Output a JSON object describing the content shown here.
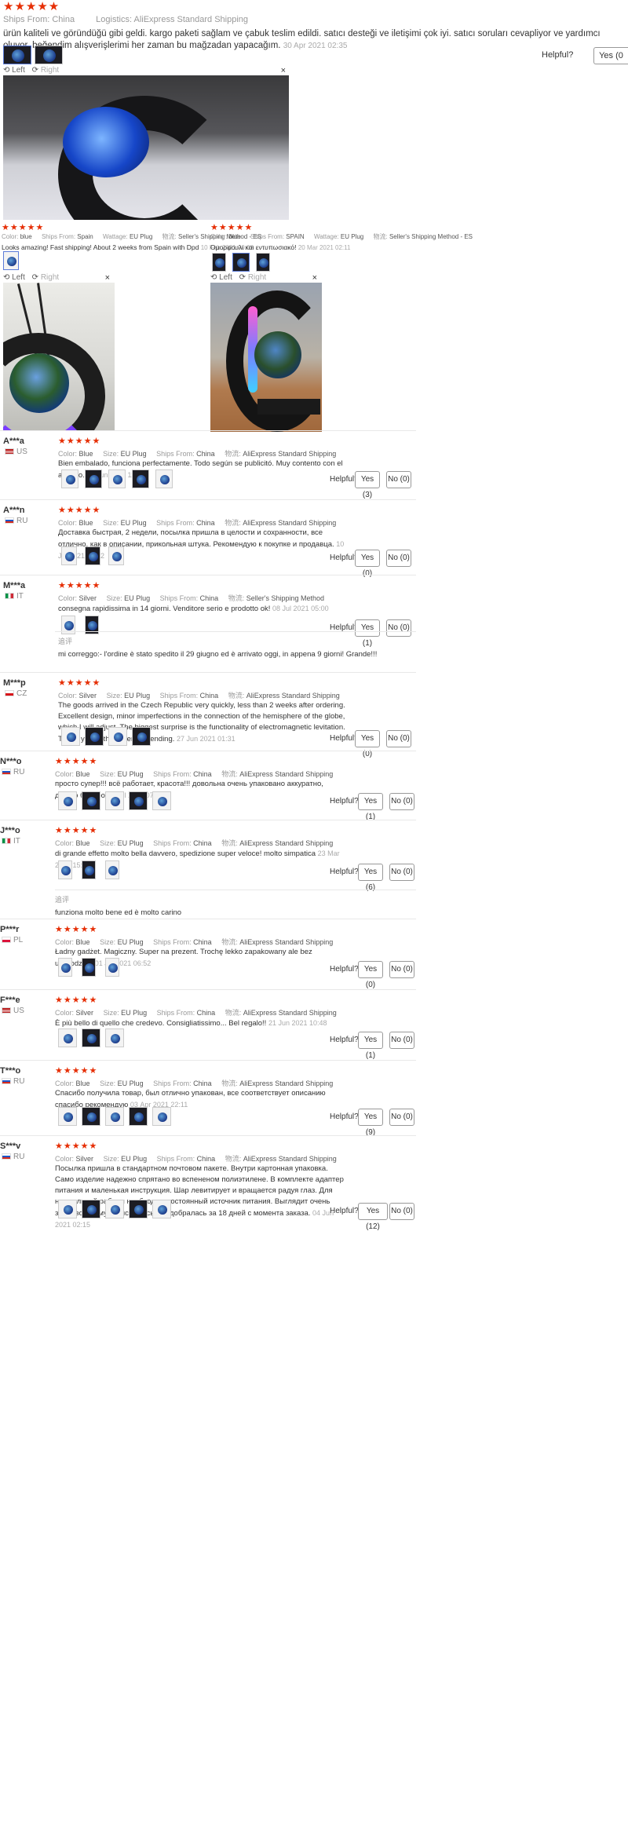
{
  "top_review": {
    "stars": "★★★★★",
    "ships_from_key": "Ships From:",
    "ships_from": "China",
    "logistics_key": "Logistics:",
    "logistics": "AliExpress Standard Shipping",
    "text": "ürün kaliteli ve göründüğü gibi geldi. kargo paketi sağlam ve çabuk teslim edildi. satıcı desteği ve iletişimi çok iyi. satıcı soruları cevapliyor ve yardımcı oluyor. beğendim alışverişlerimi her zaman bu mağzadan yapacağım.",
    "date": "30 Apr 2021 02:35",
    "helpful_label": "Helpful?",
    "yes_label": "Yes (0"
  },
  "viewer": {
    "left": "Left",
    "right": "Right",
    "close": "×"
  },
  "left_review": {
    "stars": "★★★★★",
    "color_key": "Color:",
    "color": "blue",
    "ships_key": "Ships From:",
    "ships": "Spain",
    "wattage_key": "Wattage:",
    "wattage": "EU Plug",
    "method_key": "物流:",
    "method": "Seller's Shipping Method - ES",
    "text": "Looks amazing! Fast shipping! About 2 weeks from Spain with Dpd",
    "date": "10 Feb 2021 00:08"
  },
  "right_review": {
    "stars": "★★★★★",
    "color_key": "Color:",
    "color": "blue",
    "ships_key": "Ships From:",
    "ships": "SPAIN",
    "wattage_key": "Wattage:",
    "wattage": "EU Plug",
    "method_key": "物流:",
    "method": "Seller's Shipping Method - ES",
    "text": "Ομορφουλι και εντυπωσιακό!",
    "date": "20 Mar 2021 02:11"
  },
  "reviews": [
    {
      "user": "A***a",
      "country": "US",
      "stars": "★★★★★",
      "color": "Blue",
      "size": "EU Plug",
      "ships": "China",
      "method": "AliExpress Standard Shipping",
      "text": "Bien embalado, funciona perfectamente. Todo según se publicitó. Muy contento con el artículo.",
      "date": "18 Jun 2021 11:48",
      "yes": "Yes (3)",
      "no": "No (0)"
    },
    {
      "user": "A***n",
      "country": "RU",
      "stars": "★★★★★",
      "color": "Blue",
      "size": "EU Plug",
      "ships": "China",
      "method": "AliExpress Standard Shipping",
      "text": "Доставка быстрая, 2 недели, посылка пришла в целости и сохранности, все отлично, как в описании, прикольная штука. Рекомендую к покупке и продавца.",
      "date": "10 Jul 2021 00:22",
      "yes": "Yes (0)",
      "no": "No (0)"
    },
    {
      "user": "M***a",
      "country": "IT",
      "stars": "★★★★★",
      "color": "Silver",
      "size": "EU Plug",
      "ships": "China",
      "method": "Seller's Shipping Method",
      "text": "consegna rapidissima in 14 giorni. Venditore serio e prodotto ok!",
      "date": "08 Jul 2021 05:00",
      "yes": "Yes (1)",
      "no": "No (0)",
      "followup_label": "追评",
      "followup": "mi correggo:- l'ordine è stato spedito il 29 giugno ed è arrivato oggi, in appena 9 giorni! Grande!!!"
    },
    {
      "user": "M***p",
      "country": "CZ",
      "stars": "★★★★★",
      "color": "Silver",
      "size": "EU Plug",
      "ships": "China",
      "method": "AliExpress Standard Shipping",
      "text": "The goods arrived in the Czech Republic very quickly, less than 2 weeks after ordering. Excellent design, minor imperfections in the connection of the hemisphere of the globe, which I will adjust. The biggest surprise is the functionality of electromagnetic levitation. Thank you to the seller for sending.",
      "date": "27 Jun 2021 01:31",
      "yes": "Yes (0)",
      "no": "No (0)"
    },
    {
      "user": "N***o",
      "country": "RU",
      "stars": "★★★★★",
      "color": "Blue",
      "size": "EU Plug",
      "ships": "China",
      "method": "AliExpress Standard Shipping",
      "text": "просто супер!!! всё работает, красота!!! довольна очень упаковано аккуратно, дошло быстро",
      "date": "06 Jul 2021 07:54",
      "yes": "Yes (1)",
      "no": "No (0)"
    },
    {
      "user": "J***o",
      "country": "IT",
      "stars": "★★★★★",
      "color": "Blue",
      "size": "EU Plug",
      "ships": "China",
      "method": "AliExpress Standard Shipping",
      "text": "di grande effetto molto bella davvero, spedizione super veloce! molto simpatica",
      "date": "23 Mar 2021 15:28",
      "yes": "Yes (6)",
      "no": "No (0)",
      "followup_label": "追评",
      "followup": "funziona molto bene ed è molto carino"
    },
    {
      "user": "P***r",
      "country": "PL",
      "stars": "★★★★★",
      "color": "Blue",
      "size": "EU Plug",
      "ships": "China",
      "method": "AliExpress Standard Shipping",
      "text": "Ładny gadżet. Magiczny. Super na prezent. Trochę lekko zapakowany ale bez uszkodzeń.",
      "date": "01 Jul 2021 06:52",
      "yes": "Yes (0)",
      "no": "No (0)"
    },
    {
      "user": "F***e",
      "country": "US",
      "stars": "★★★★★",
      "color": "Silver",
      "size": "EU Plug",
      "ships": "China",
      "method": "AliExpress Standard Shipping",
      "text": "È più bello di quello che credevo. Consigliatissimo... Bel regalo!!",
      "date": "21 Jun 2021 10:48",
      "yes": "Yes (1)",
      "no": "No (0)"
    },
    {
      "user": "T***o",
      "country": "RU",
      "stars": "★★★★★",
      "color": "Blue",
      "size": "EU Plug",
      "ships": "China",
      "method": "AliExpress Standard Shipping",
      "text": "Спасибо получила товар, был отлично упакован, все соответствует описанию спасибо рекомендую",
      "date": "03 Apr 2021 22:11",
      "yes": "Yes (9)",
      "no": "No (0)"
    },
    {
      "user": "S***v",
      "country": "RU",
      "stars": "★★★★★",
      "color": "Silver",
      "size": "EU Plug",
      "ships": "China",
      "method": "AliExpress Standard Shipping",
      "text": "Посылка пришла в стандартном почтовом пакете. Внутри картонная упаковка. Само изделие надежно спрятано во вспененом полиэтилене. В комплекте адаптер питания и маленькая инструкция. Шар левитирует и вращается радуя глаз. Для нормальной работы необходим постоянный источник питания. Выглядит очень здорово. До мурманска посылка добралась за 18 дней с момента заказа.",
      "date": "04 Jun 2021 02:15",
      "yes": "Yes (12)",
      "no": "No (0)"
    }
  ],
  "labels": {
    "color": "Color:",
    "size": "Size:",
    "ships": "Ships From:",
    "method": "物流:",
    "helpful": "Helpful?"
  }
}
